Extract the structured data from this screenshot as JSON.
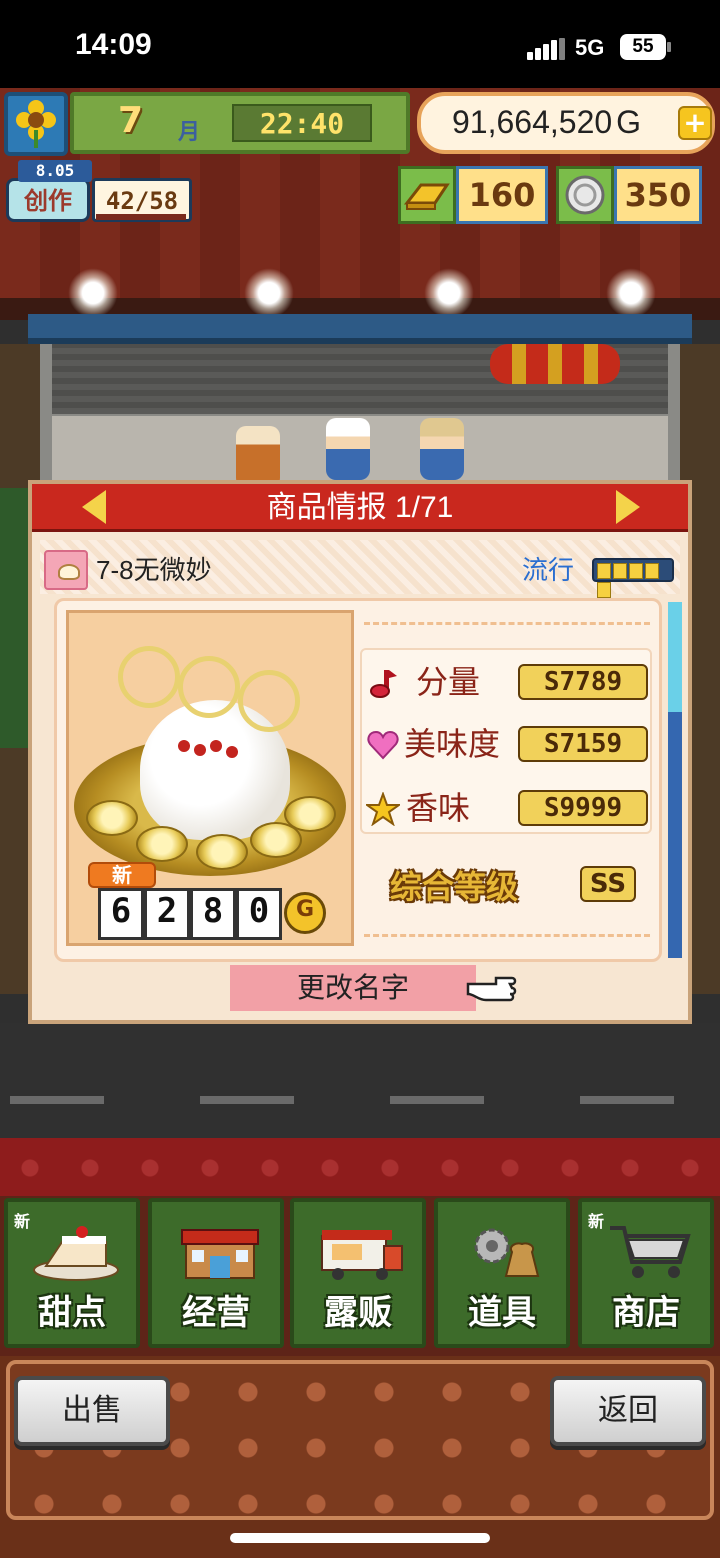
{
  "status_bar": {
    "time": "14:09",
    "network": "5G",
    "battery": "55"
  },
  "hud": {
    "month_number": "7",
    "month_unit": "月",
    "clock": "22:40",
    "money": "91,664,520",
    "money_unit": "G",
    "money_plus": "+",
    "create_date": "8.05",
    "create_label": "创作",
    "create_count": "42/58",
    "gold_bars": "160",
    "medals": "350"
  },
  "dialog": {
    "title": "商品情报 1/71",
    "product_name": "7-8无微妙",
    "trend_label": "流行",
    "trend_level": 5,
    "new_badge": "新",
    "price_digits": [
      "6",
      "2",
      "8",
      "0"
    ],
    "price_unit": "G",
    "stats": [
      {
        "icon": "music-note-icon",
        "label": "分量",
        "value": "S7789"
      },
      {
        "icon": "heart-icon",
        "label": "美味度",
        "value": "S7159"
      },
      {
        "icon": "star-icon",
        "label": "香味",
        "value": "S9999"
      }
    ],
    "overall_label": "综合等级",
    "overall_value": "SS",
    "rename_button": "更改名字"
  },
  "nav": [
    {
      "label": "甜点",
      "badge": "新",
      "icon": "cake-icon"
    },
    {
      "label": "经营",
      "badge": "",
      "icon": "shop-icon"
    },
    {
      "label": "露贩",
      "badge": "",
      "icon": "food-truck-icon"
    },
    {
      "label": "道具",
      "badge": "",
      "icon": "items-icon"
    },
    {
      "label": "商店",
      "badge": "新",
      "icon": "cart-icon"
    }
  ],
  "buttons": {
    "sell": "出售",
    "back": "返回"
  },
  "colors": {
    "header_red": "#c9281e",
    "nav_green": "#3d6b2a",
    "trend_blue": "#2a6ed0"
  }
}
